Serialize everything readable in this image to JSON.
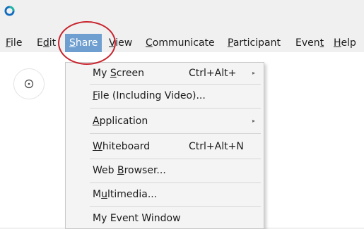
{
  "menubar": {
    "items": [
      {
        "label_pre": "",
        "label_ul": "F",
        "label_post": "ile"
      },
      {
        "label_pre": "E",
        "label_ul": "d",
        "label_post": "it"
      },
      {
        "label_pre": "",
        "label_ul": "S",
        "label_post": "hare"
      },
      {
        "label_pre": "",
        "label_ul": "V",
        "label_post": "iew"
      },
      {
        "label_pre": "",
        "label_ul": "C",
        "label_post": "ommunicate"
      },
      {
        "label_pre": "",
        "label_ul": "P",
        "label_post": "articipant"
      },
      {
        "label_pre": "Even",
        "label_ul": "t",
        "label_post": ""
      },
      {
        "label_pre": "",
        "label_ul": "H",
        "label_post": "elp"
      }
    ]
  },
  "share_menu": {
    "items": [
      {
        "label_pre": "My ",
        "label_ul": "S",
        "label_post": "creen",
        "shortcut": "Ctrl+Alt+",
        "submenu": true
      },
      {
        "label_pre": "",
        "label_ul": "F",
        "label_post": "ile (Including Video)...",
        "shortcut": "",
        "submenu": false
      },
      {
        "label_pre": "",
        "label_ul": "A",
        "label_post": "pplication",
        "shortcut": "",
        "submenu": true
      },
      {
        "label_pre": "",
        "label_ul": "W",
        "label_post": "hiteboard",
        "shortcut": "Ctrl+Alt+N",
        "submenu": false
      },
      {
        "label_pre": "Web ",
        "label_ul": "B",
        "label_post": "rowser...",
        "shortcut": "",
        "submenu": false
      },
      {
        "label_pre": "M",
        "label_ul": "u",
        "label_post": "ltimedia...",
        "shortcut": "",
        "submenu": false
      },
      {
        "label_pre": "My Event Window",
        "label_ul": "",
        "label_post": "",
        "shortcut": "",
        "submenu": false
      }
    ],
    "submenu_arrow": "▸"
  },
  "side_button": {
    "icon": "info-circle-icon"
  },
  "colors": {
    "menubar_bg": "#f0f0f0",
    "active_menu_bg": "#6f9fd0",
    "annotation_ring": "#c8232c",
    "logo_blue": "#0f6cbd",
    "logo_teal": "#1fb5a3"
  }
}
